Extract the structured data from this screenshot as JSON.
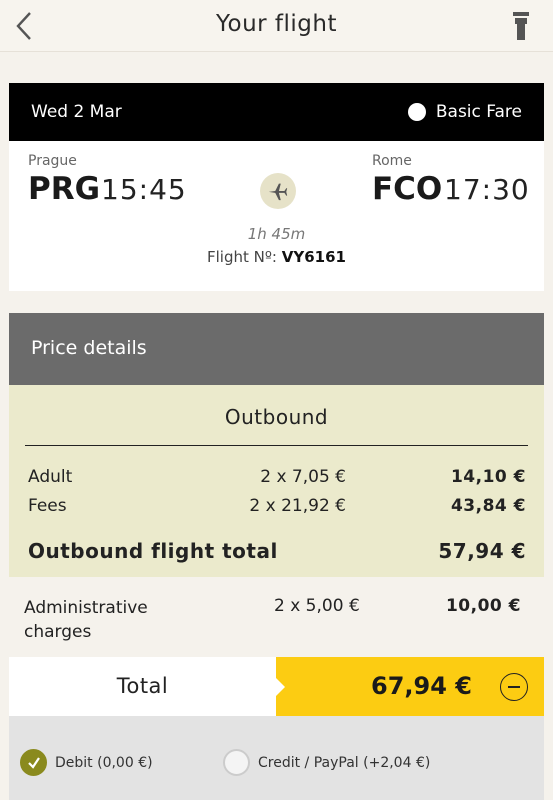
{
  "header": {
    "title": "Your flight",
    "back_icon": "chevron-left-icon",
    "right_icon": "control-tower-icon"
  },
  "flight": {
    "date": "Wed 2 Mar",
    "fare": "Basic Fare",
    "origin": {
      "city": "Prague",
      "code": "PRG",
      "time": "15:45"
    },
    "destination": {
      "city": "Rome",
      "code": "FCO",
      "time": "17:30"
    },
    "duration": "1h 45m",
    "flight_no_label": "Flight Nº:",
    "flight_no": "VY6161"
  },
  "price": {
    "header": "Price details",
    "outbound_title": "Outbound",
    "rows": [
      {
        "label": "Adult",
        "qty": "2 x 7,05 €",
        "amount": "14,10 €"
      },
      {
        "label": "Fees",
        "qty": "2 x 21,92 €",
        "amount": "43,84 €"
      }
    ],
    "outbound_total_label": "Outbound flight total",
    "outbound_total": "57,94 €",
    "admin": {
      "label": "Administrative charges",
      "qty": "2 x 5,00 €",
      "amount": "10,00 €"
    },
    "total_label": "Total",
    "total": "67,94 €"
  },
  "payment": {
    "options": [
      {
        "label": "Debit (0,00 €)",
        "selected": true
      },
      {
        "label": "Credit / PayPal (+2,04 €)",
        "selected": false
      }
    ]
  },
  "colors": {
    "accent": "#fccc12",
    "price_header": "#6b6b6b",
    "outbound_bg": "#ebeacc",
    "selected_radio": "#8a8a1e"
  }
}
